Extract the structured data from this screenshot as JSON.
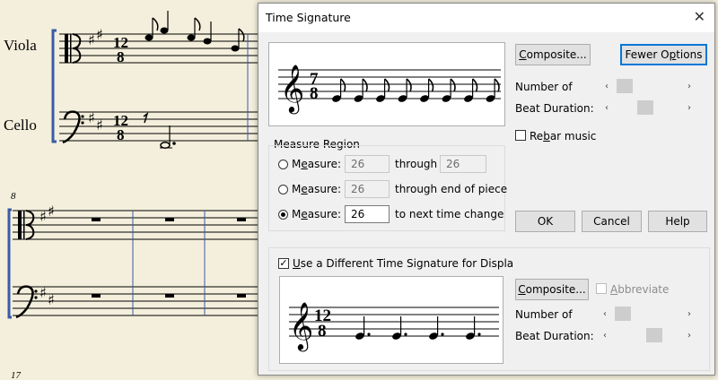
{
  "score": {
    "instruments": [
      "Viola",
      "Cello"
    ],
    "measure_numbers": [
      "8",
      "17"
    ],
    "time_signature": {
      "top": "12",
      "bottom": "8"
    }
  },
  "dialog": {
    "title": "Time Signature",
    "top_preview": {
      "time_top": "7",
      "time_bottom": "8",
      "note_count": 8
    },
    "composite_button": "Composite...",
    "fewer_options_button": "Fewer Options",
    "number_of_label": "Number of",
    "beat_duration_label": "Beat Duration:",
    "number_of_position": 0.05,
    "beat_duration_position": 0.45,
    "rebar_label": "Rebar music",
    "rebar_checked": false,
    "measure_region": {
      "title": "Measure Region",
      "rows": [
        {
          "label": "Measure:",
          "value": "26",
          "suffix": "through",
          "value2": "26",
          "selected": false
        },
        {
          "label": "Measure:",
          "value": "26",
          "suffix": "through end of piece",
          "selected": false
        },
        {
          "label": "Measure:",
          "value": "26",
          "suffix": "to next time change",
          "selected": true
        }
      ]
    },
    "ok_button": "OK",
    "cancel_button": "Cancel",
    "help_button": "Help",
    "display": {
      "checkbox_label": "Use a Different Time Signature for Displa",
      "checked": true,
      "composite_button": "Composite...",
      "abbreviate_label": "Abbreviate",
      "abbreviate_checked": false,
      "number_of_label": "Number of",
      "beat_duration_label": "Beat Duration:",
      "number_of_position": 0.05,
      "beat_duration_position": 0.62,
      "preview": {
        "time_top": "12",
        "time_bottom": "8",
        "note_count": 4
      }
    }
  }
}
